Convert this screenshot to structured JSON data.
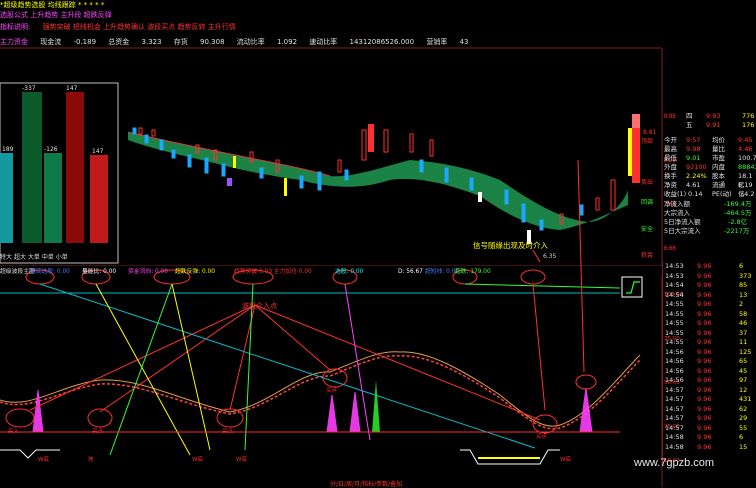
{
  "header": {
    "line1": "*超级趋势选股  均线跟踪  *  *  *  *  *",
    "line2": "选股公式  上升趋势  主升段  超跌反弹",
    "line3_items": [
      "指标说明:",
      "强势突破 短线机会 上升趋势确认 波段买点 趋势反转 主升行情"
    ],
    "line4_items": [
      "主力资金",
      "现金流",
      "-0.189",
      "总资金",
      "3.323",
      "存货",
      "90.308",
      "流动比率",
      "1.092",
      "速动比率",
      "14312086526.000",
      "营销率",
      "43"
    ]
  },
  "left_chart": {
    "labels": [
      "-337",
      "147",
      "189",
      "-126",
      "147"
    ],
    "legend": [
      "特大",
      "超大",
      "大单",
      "中单",
      "小单"
    ]
  },
  "main_chart": {
    "annotations": [
      "8.81",
      "6.35",
      "信号随缘出现及时介入"
    ],
    "right_labels": [
      "顶部",
      "卖出",
      "回调",
      "安全",
      "机会"
    ]
  },
  "indicator_bar": {
    "label": "超级波段主图",
    "items": [
      {
        "text": "W底选股: 0.00",
        "color": "#4a7bff"
      },
      {
        "text": "量能比: 0.00",
        "color": "#ffffff"
      },
      {
        "text": "资金流向: 0.00",
        "color": "#ff40ff"
      },
      {
        "text": "超跌反弹: 0.00",
        "color": "#ffff00"
      },
      {
        "text": "趋势突破 0.00 主力加仓 0.00",
        "color": "#ff3030"
      },
      {
        "text": "选股: 0.00",
        "color": "#00ffff"
      },
      {
        "text": "D: 56.67",
        "color": "#ffffff"
      },
      {
        "text": "超短线: 0.00",
        "color": "#4a7bff"
      },
      {
        "text": "超跌: 179.00",
        "color": "#30ff30"
      }
    ]
  },
  "lower_chart": {
    "annotation": "波段介入点",
    "signals": [
      "买入",
      "买点",
      "买点",
      "买点",
      "买点"
    ],
    "bottom_labels": [
      "W底",
      "地",
      "W底",
      "W底",
      "W底"
    ]
  },
  "quote": {
    "rows": [
      {
        "label": "四",
        "v1": "9.93",
        "v2": "776"
      },
      {
        "label": "五",
        "v1": "9.91",
        "v2": "176"
      },
      {
        "label": "今开",
        "v1": "9.57",
        "label2": "均价",
        "v2": "9.45"
      },
      {
        "label": "最高",
        "v1": "9.98",
        "label2": "量比",
        "v2": "4.46"
      },
      {
        "label": "最低",
        "v1": "9.01",
        "label2": "市盈",
        "v2": "100.7"
      },
      {
        "label": "外盘",
        "v1": "92100",
        "label2": "内盘",
        "v2": "88843"
      },
      {
        "label": "换手",
        "v1": "2.24%",
        "label2": "股本",
        "v2": "18.1亿"
      },
      {
        "label": "净资",
        "v1": "4.61",
        "label2": "流通",
        "v2": "8.19亿"
      },
      {
        "label": "收益(1)",
        "v1": "0.14",
        "label2": "PE(动)",
        "v2": "54.2"
      },
      {
        "label": "净流入额",
        "v1": "",
        "label2": "",
        "v2": "-169.4万"
      },
      {
        "label": "大宗流入",
        "v1": "",
        "label2": "",
        "v2": "-464.5万"
      },
      {
        "label": "5日净流入额",
        "v1": "",
        "label2": "",
        "v2": "-2.8亿"
      },
      {
        "label": "5日大宗流入",
        "v1": "",
        "label2": "",
        "v2": "-2217万"
      }
    ]
  },
  "ticks": {
    "rows": [
      {
        "time": "14:53",
        "price": "9.96",
        "vol": "6"
      },
      {
        "time": "14:53",
        "price": "9.96",
        "vol": "373"
      },
      {
        "time": "14:54",
        "price": "9.96",
        "vol": "85"
      },
      {
        "time": "14:54",
        "price": "9.96",
        "vol": "13"
      },
      {
        "time": "14:55",
        "price": "9.96",
        "vol": "2"
      },
      {
        "time": "14:55",
        "price": "9.96",
        "vol": "58"
      },
      {
        "time": "14:55",
        "price": "9.96",
        "vol": "46"
      },
      {
        "time": "14:55",
        "price": "9.96",
        "vol": "37"
      },
      {
        "time": "14:55",
        "price": "9.96",
        "vol": "11"
      },
      {
        "time": "14:56",
        "price": "9.96",
        "vol": "125"
      },
      {
        "time": "14:56",
        "price": "9.96",
        "vol": "65"
      },
      {
        "time": "14:56",
        "price": "9.96",
        "vol": "45"
      },
      {
        "time": "14:56",
        "price": "9.96",
        "vol": "97"
      },
      {
        "time": "14:57",
        "price": "9.96",
        "vol": "12"
      },
      {
        "time": "14:57",
        "price": "9.96",
        "vol": "431"
      },
      {
        "time": "14:57",
        "price": "9.96",
        "vol": "62"
      },
      {
        "time": "14:57",
        "price": "9.96",
        "vol": "29"
      },
      {
        "time": "14:57",
        "price": "9.96",
        "vol": "55"
      },
      {
        "time": "14:58",
        "price": "9.96",
        "vol": "6"
      },
      {
        "time": "14:58",
        "price": "9.96",
        "vol": "15"
      }
    ]
  },
  "watermark": "www.7gpzb.com",
  "bottom_tabs": "分/日/周/月/指标/参数/叠加"
}
